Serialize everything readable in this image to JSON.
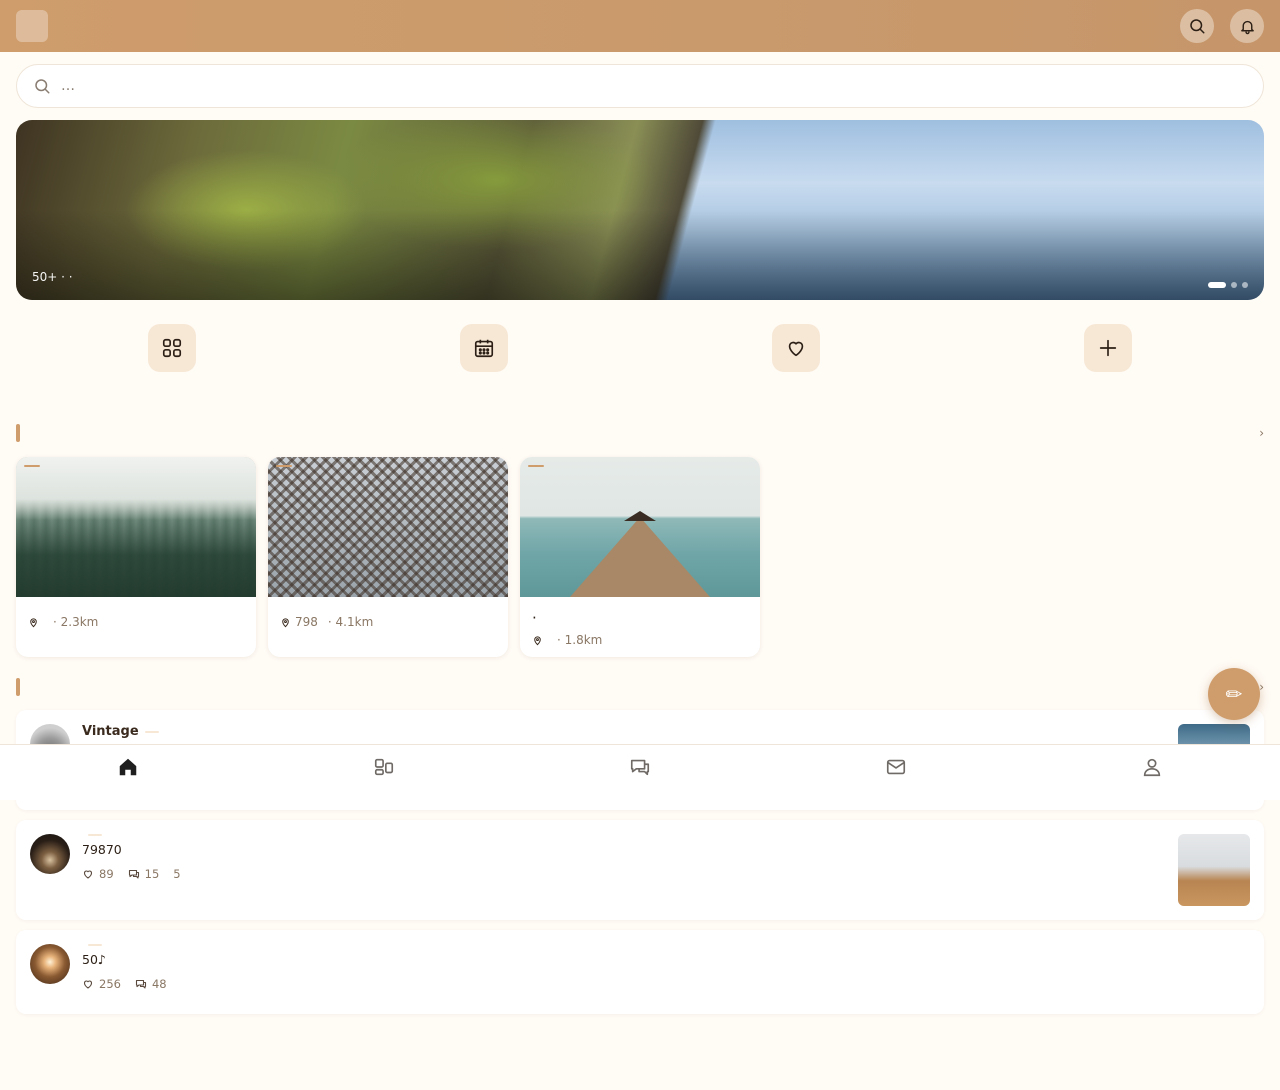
{
  "header": {
    "logo_glyph": "",
    "title": "",
    "search_icon": "search-icon",
    "bell_icon": "bell-icon"
  },
  "search": {
    "placeholder": "…"
  },
  "banner": {
    "title": "",
    "subtitle": "50+ ·  · ",
    "slides": 3,
    "active_slide": 0
  },
  "quick_actions": [
    {
      "label": "",
      "icon": "grid-icon"
    },
    {
      "label": "",
      "icon": "calendar-icon"
    },
    {
      "label": "",
      "icon": "heart-icon"
    },
    {
      "label": "",
      "icon": "plus-icon"
    }
  ],
  "section_spots": {
    "title": "",
    "more": " ›"
  },
  "cards": [
    {
      "tag": "",
      "title": "",
      "location": "",
      "distance": "· 2.3km"
    },
    {
      "tag": "",
      "title": "",
      "location": "798",
      "distance": "· 4.1km"
    },
    {
      "tag": "",
      "title": "·",
      "location": "",
      "distance": "· 1.8km"
    }
  ],
  "section_posts": {
    "title": "",
    "more": "›"
  },
  "posts": [
    {
      "user": "Vintage",
      "tag": "",
      "text": "",
      "likes": "",
      "comments": "",
      "time": ""
    },
    {
      "user": "",
      "tag": "",
      "text": "79870 ",
      "likes": "89",
      "comments": "15",
      "time": "5"
    },
    {
      "user": "",
      "tag": "",
      "text": "50♪",
      "likes": "256",
      "comments": "48",
      "time": ""
    }
  ],
  "fab": {
    "glyph": "✏"
  },
  "bottom_nav": [
    {
      "label": "",
      "icon": "home-icon",
      "active": true
    },
    {
      "label": "",
      "icon": "discover-icon",
      "active": false
    },
    {
      "label": "",
      "icon": "chat-icon",
      "active": false
    },
    {
      "label": "",
      "icon": "mail-icon",
      "active": false
    },
    {
      "label": "",
      "icon": "user-icon",
      "active": false
    }
  ],
  "colors": {
    "accent": "#cf9d6c",
    "accent_light": "#f7e8d6",
    "background": "#fffbf5",
    "text": "#2c1f15",
    "muted": "#8a7764"
  }
}
